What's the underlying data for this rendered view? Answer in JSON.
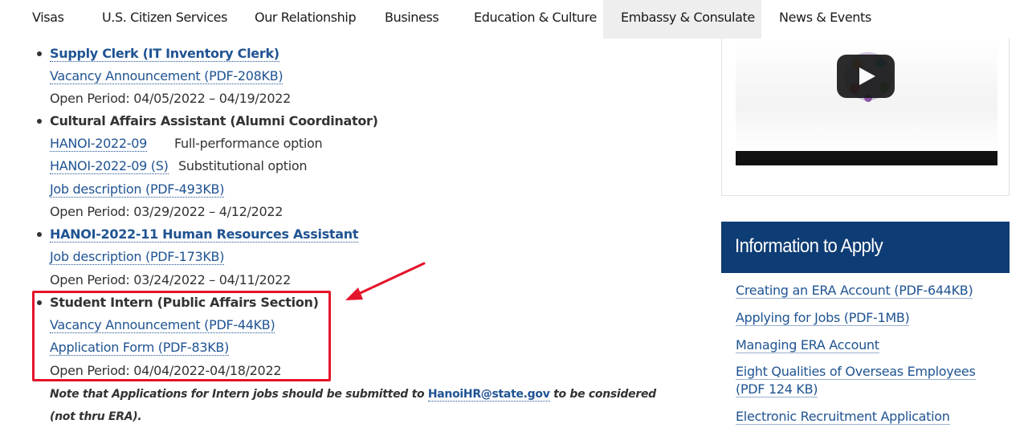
{
  "nav": {
    "items": [
      {
        "label": "Visas"
      },
      {
        "label": "U.S. Citizen Services"
      },
      {
        "label": "Our Relationship"
      },
      {
        "label": "Business"
      },
      {
        "label": "Education & Culture"
      },
      {
        "label": "Embassy & Consulate",
        "active": true
      },
      {
        "label": "News & Events"
      }
    ]
  },
  "jobs": {
    "job1": {
      "title": "Supply Clerk (IT Inventory Clerk)",
      "doc": "Vacancy Announcement (PDF-208KB)",
      "period": "Open Period: 04/05/2022 – 04/19/2022"
    },
    "job2": {
      "title": "Cultural Affairs Assistant (Alumni Coordinator)",
      "link1": "HANOI-2022-09",
      "note1": "Full-performance option",
      "link2": "HANOI-2022-09 (S)",
      "note2": "Substitutional option",
      "doc": "Job description (PDF-493KB)",
      "period": "Open Period: 03/29/2022 – 4/12/2022"
    },
    "job3": {
      "title": "HANOI-2022-11 Human Resources Assistant",
      "doc": "Job description (PDF-173KB)",
      "period": "Open Period: 03/24/2022 – 04/11/2022"
    },
    "job4": {
      "title": "Student Intern (Public Affairs Section)",
      "doc1": "Vacancy Announcement (PDF-44KB)",
      "doc2": "Application Form (PDF-83KB)",
      "period": "Open Period: 04/04/2022-04/18/2022"
    },
    "note": {
      "before": "Note that Applications for Intern jobs should be submitted to ",
      "email": "HanoiHR@state.gov",
      "after": " to be considered (not thru ERA)."
    }
  },
  "sidebar": {
    "video": {
      "icon": "play-icon"
    },
    "info_title": "Information to Apply",
    "links": [
      "Creating an ERA Account (PDF-644KB)",
      "Applying for Jobs (PDF-1MB)",
      "Managing ERA Account",
      "Eight Qualities of Overseas Employees (PDF 124 KB)",
      "Electronic Recruitment Application"
    ]
  },
  "colors": {
    "link": "#205493",
    "header_bg": "#0e3c74",
    "annotation": "#e4142a",
    "active_tab": "#eeeeee"
  }
}
